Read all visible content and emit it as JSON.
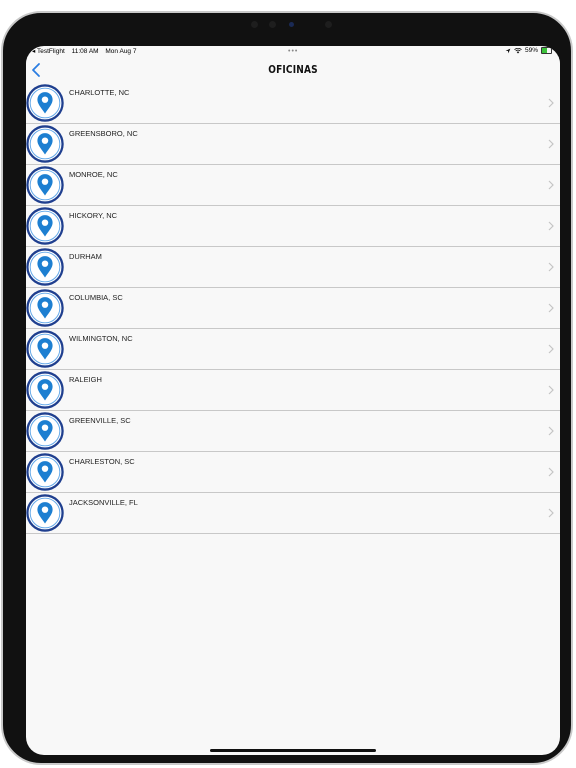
{
  "status_bar": {
    "app": "◂ TestFlight",
    "time": "11:08 AM",
    "date": "Mon Aug 7",
    "battery": "59%",
    "battery_level": 0.59
  },
  "multitask": "•••",
  "nav": {
    "title": "OFICINAS",
    "back_icon": "chevron-left-icon"
  },
  "offices": [
    {
      "name": "CHARLOTTE, NC"
    },
    {
      "name": "GREENSBORO, NC"
    },
    {
      "name": "MONROE, NC"
    },
    {
      "name": "HICKORY, NC"
    },
    {
      "name": "DURHAM"
    },
    {
      "name": "COLUMBIA, SC"
    },
    {
      "name": "WILMINGTON, NC"
    },
    {
      "name": "RALEIGH"
    },
    {
      "name": "GREENVILLE, SC"
    },
    {
      "name": "CHARLESTON, SC"
    },
    {
      "name": "JACKSONVILLE, FL"
    }
  ],
  "colors": {
    "accent": "#2a7de1",
    "pin_ring": "#1f3f8f",
    "pin_fill": "#1d7fd1",
    "divider": "#c8c8c8",
    "battery": "#3cc13b"
  }
}
